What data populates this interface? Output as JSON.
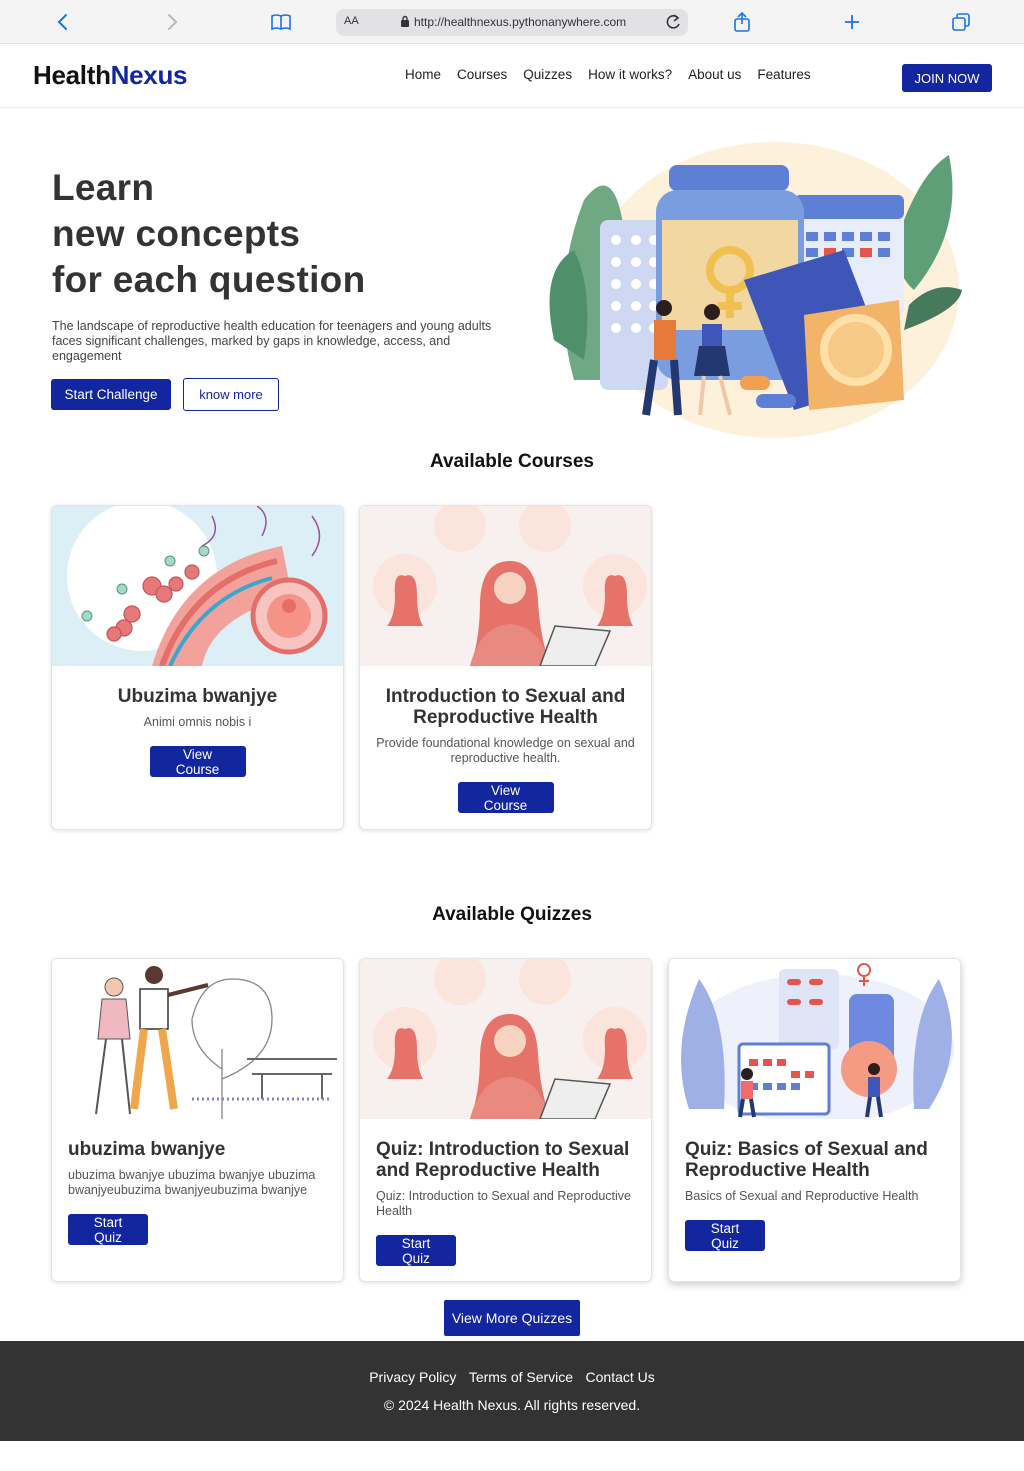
{
  "browser": {
    "url": "http://healthnexus.pythonanywhere.com",
    "reader_label": "AA"
  },
  "nav": {
    "logo_part1": "Health",
    "logo_part2": "Nexus",
    "links": [
      "Home",
      "Courses",
      "Quizzes",
      "How it works?",
      "About us",
      "Features"
    ],
    "join_label": "JOIN NOW"
  },
  "hero": {
    "title_lines": [
      "Learn",
      "new concepts",
      "for each question"
    ],
    "description": "The landscape of reproductive health education for teenagers and young adults faces significant challenges, marked by gaps in knowledge, access, and engagement",
    "start_label": "Start Challenge",
    "know_label": "know more"
  },
  "courses": {
    "title": "Available Courses",
    "items": [
      {
        "title": "Ubuzima bwanjye",
        "description": "Animi omnis nobis i",
        "button": "View Course"
      },
      {
        "title": "Introduction to Sexual and Reproductive Health",
        "description": "Provide foundational knowledge on sexual and reproductive health.",
        "button": "View Course"
      }
    ]
  },
  "quizzes": {
    "title": "Available Quizzes",
    "items": [
      {
        "title": "ubuzima bwanjye",
        "description": "ubuzima bwanjye ubuzima bwanjye ubuzima bwanjyeubuzima bwanjyeubuzima bwanjye",
        "button": "Start Quiz"
      },
      {
        "title": "Quiz: Introduction to Sexual and Reproductive Health",
        "description": "Quiz: Introduction to Sexual and Reproductive Health",
        "button": "Start Quiz"
      },
      {
        "title": "Quiz: Basics of Sexual and Reproductive Health",
        "description": "Basics of Sexual and Reproductive Health",
        "button": "Start Quiz"
      }
    ],
    "more_label": "View More Quizzes"
  },
  "footer": {
    "links": [
      "Privacy Policy",
      "Terms of Service",
      "Contact Us"
    ],
    "copyright": "© 2024 Health Nexus. All rights reserved."
  },
  "colors": {
    "brand": "#1226a0",
    "footer_bg": "#333333"
  },
  "icons": [
    "back-icon",
    "forward-icon",
    "book-icon",
    "lock-icon",
    "reload-icon",
    "share-icon",
    "plus-icon",
    "tabs-icon"
  ]
}
